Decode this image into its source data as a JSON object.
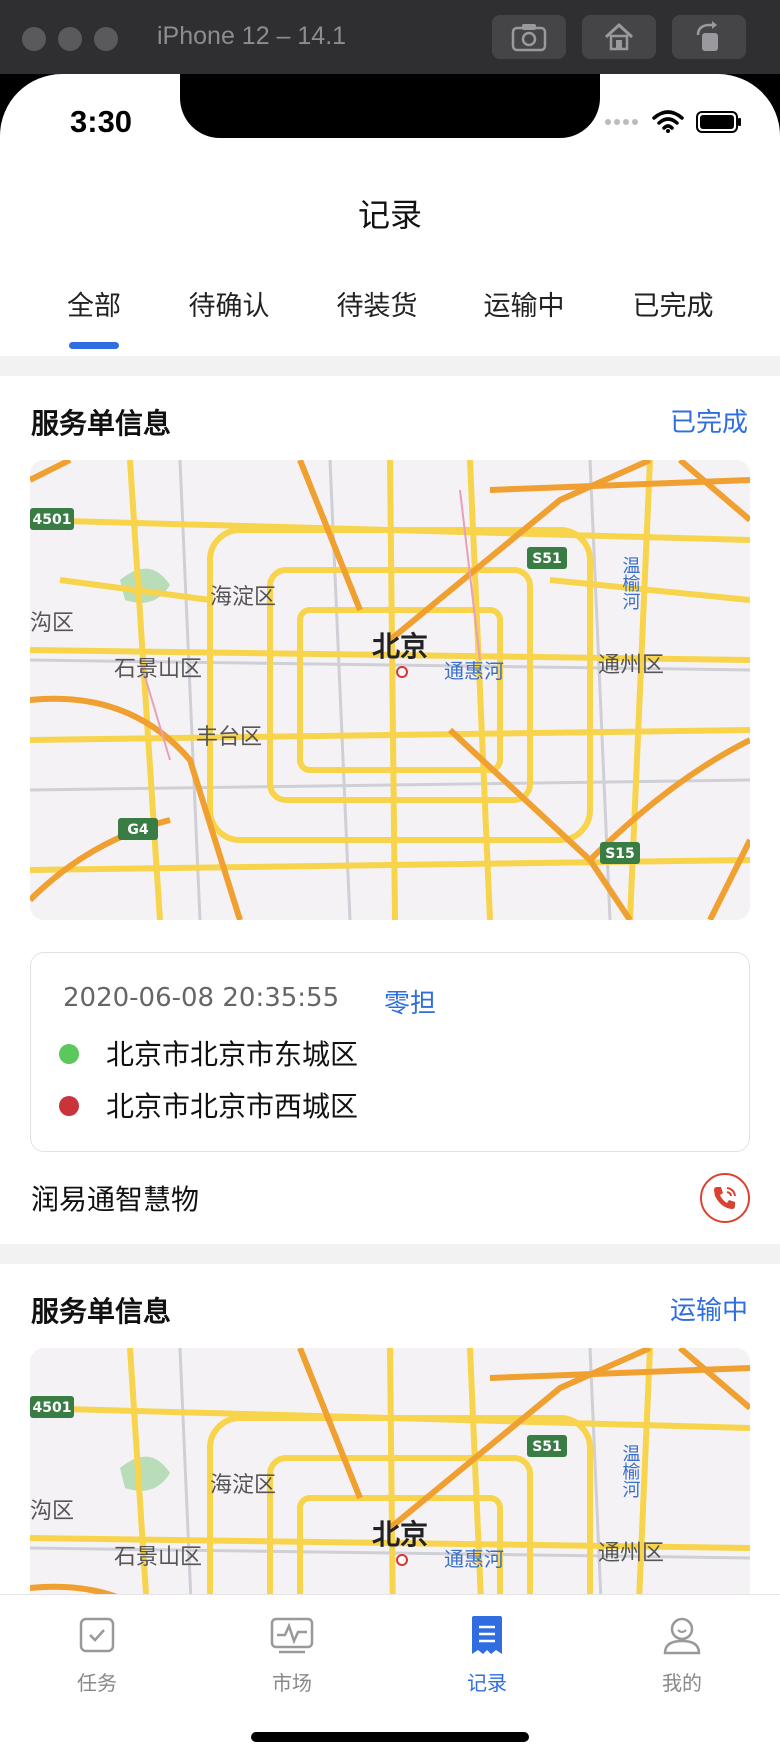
{
  "simulator": {
    "title": "iPhone 12 – 14.1"
  },
  "status_bar": {
    "time": "3:30"
  },
  "nav": {
    "title": "记录"
  },
  "tabs": [
    "全部",
    "待确认",
    "待装货",
    "运输中",
    "已完成"
  ],
  "tabs_active_index": 0,
  "map_labels": {
    "haidian": "海淀区",
    "shijingshan": "石景山区",
    "fengtai": "丰台区",
    "beijing": "北京",
    "tonghuihe": "通惠河",
    "tongzhou": "通州区",
    "gou": "沟区",
    "wenyu": "温榆河",
    "s51": "S51",
    "s15": "S15",
    "g4": "G4",
    "r4501": "4501"
  },
  "orders": [
    {
      "title": "服务单信息",
      "status": "已完成",
      "date": "2020-06-08 20:35:55",
      "type": "零担",
      "from": "北京市北京市东城区",
      "to": "北京市北京市西城区",
      "company": "润易通智慧物"
    },
    {
      "title": "服务单信息",
      "status": "运输中"
    }
  ],
  "tabbar": [
    {
      "label": "任务",
      "icon": "task-icon"
    },
    {
      "label": "市场",
      "icon": "market-icon"
    },
    {
      "label": "记录",
      "icon": "record-icon"
    },
    {
      "label": "我的",
      "icon": "profile-icon"
    }
  ],
  "colors": {
    "accent": "#2f6de1",
    "from_dot": "#5ac85a",
    "to_dot": "#c9343a",
    "phone": "#d9432f"
  }
}
